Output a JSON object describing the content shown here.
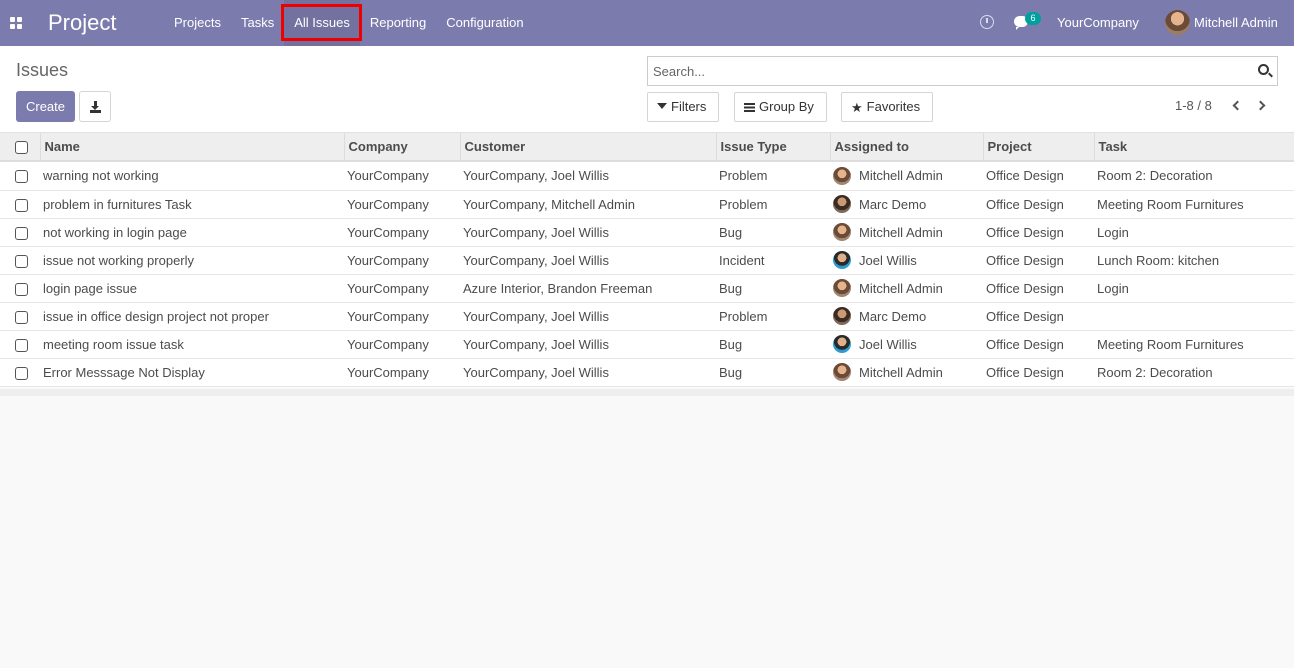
{
  "navbar": {
    "brand": "Project",
    "menu": [
      {
        "label": "Projects"
      },
      {
        "label": "Tasks"
      },
      {
        "label": "All Issues"
      },
      {
        "label": "Reporting"
      },
      {
        "label": "Configuration"
      }
    ],
    "active_menu": "All Issues",
    "messages_count": "6",
    "company": "YourCompany",
    "user": "Mitchell Admin"
  },
  "control_panel": {
    "breadcrumb": "Issues",
    "create_label": "Create",
    "search_placeholder": "Search...",
    "filters_label": "Filters",
    "group_by_label": "Group By",
    "favorites_label": "Favorites",
    "pager": "1-8 / 8"
  },
  "table": {
    "columns": [
      "Name",
      "Company",
      "Customer",
      "Issue Type",
      "Assigned to",
      "Project",
      "Task"
    ],
    "rows": [
      {
        "name": "warning not working",
        "company": "YourCompany",
        "customer": "YourCompany, Joel Willis",
        "issue_type": "Problem",
        "assigned_to": "Mitchell Admin",
        "project": "Office Design",
        "task": "Room 2: Decoration"
      },
      {
        "name": "problem in furnitures Task",
        "company": "YourCompany",
        "customer": "YourCompany, Mitchell Admin",
        "issue_type": "Problem",
        "assigned_to": "Marc Demo",
        "project": "Office Design",
        "task": "Meeting Room Furnitures"
      },
      {
        "name": "not working in login page",
        "company": "YourCompany",
        "customer": "YourCompany, Joel Willis",
        "issue_type": "Bug",
        "assigned_to": "Mitchell Admin",
        "project": "Office Design",
        "task": "Login"
      },
      {
        "name": "issue not working properly",
        "company": "YourCompany",
        "customer": "YourCompany, Joel Willis",
        "issue_type": "Incident",
        "assigned_to": "Joel Willis",
        "project": "Office Design",
        "task": "Lunch Room: kitchen"
      },
      {
        "name": "login page issue",
        "company": "YourCompany",
        "customer": "Azure Interior, Brandon Freeman",
        "issue_type": "Bug",
        "assigned_to": "Mitchell Admin",
        "project": "Office Design",
        "task": "Login"
      },
      {
        "name": "issue in office design project not proper",
        "company": "YourCompany",
        "customer": "YourCompany, Joel Willis",
        "issue_type": "Problem",
        "assigned_to": "Marc Demo",
        "project": "Office Design",
        "task": ""
      },
      {
        "name": "meeting room issue task",
        "company": "YourCompany",
        "customer": "YourCompany, Joel Willis",
        "issue_type": "Bug",
        "assigned_to": "Joel Willis",
        "project": "Office Design",
        "task": "Meeting Room Furnitures"
      },
      {
        "name": "Error Messsage Not Display",
        "company": "YourCompany",
        "customer": "YourCompany, Joel Willis",
        "issue_type": "Bug",
        "assigned_to": "Mitchell Admin",
        "project": "Office Design",
        "task": "Room 2: Decoration"
      }
    ]
  },
  "colors": {
    "navbar": "#7c7bad",
    "primary_button": "#7c7bad",
    "badge": "#00a09d",
    "highlight": "#ee0000"
  }
}
